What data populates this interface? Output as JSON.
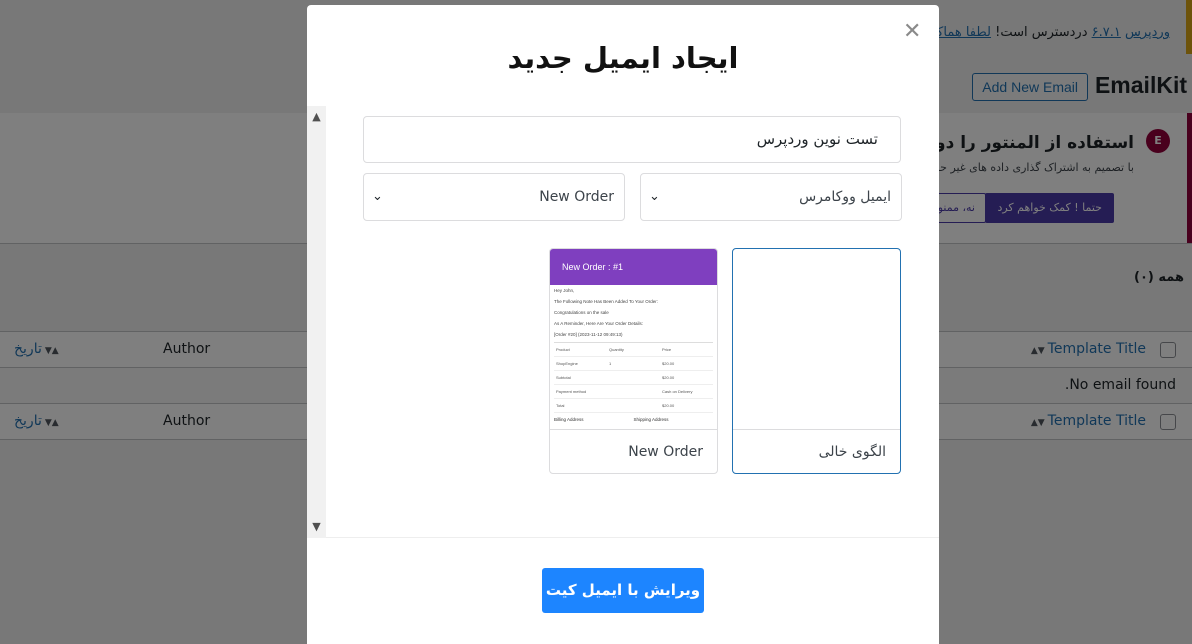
{
  "background": {
    "notice_text_1": "وردپرس",
    "notice_version": "۶.۷.۱",
    "notice_text_2": "دردسترس است!",
    "notice_link": "لطفا هماکنون",
    "page_title": "EmailKit",
    "add_new_label": "Add New Email",
    "elementor_logo": "E",
    "elementor_title": "استفاده از المنتور را دوستانه‌تر کنید",
    "elementor_desc": "با تصمیم به اشتراک گذاری داده های غیر حساس",
    "elementor_yes": "حتما ! کمک خواهم کرد",
    "elementor_no": "نه، ممنون",
    "filter_all": "همه (۰)",
    "table": {
      "col_title": "Template Title",
      "col_author": "Author",
      "col_date": "تاریخ",
      "empty": ".No email found"
    }
  },
  "modal": {
    "title": "ایجاد ایمیل جدید",
    "close_glyph": "✕",
    "name_value": "تست نوین وردپرس",
    "type_select": "ایمیل ووکامرس",
    "event_select": "New Order",
    "templates": [
      {
        "label": "الگوی خالی"
      },
      {
        "label": "New Order"
      }
    ],
    "preview": {
      "header": "New Order : #1",
      "greeting": "Hey John,",
      "line1": "The Following Note Has Been Added To Your Order:",
      "line2": "Congratulations on the sale",
      "line3": "As A Reminder, Here Are Your Order Details:",
      "order_ref": "[Order #20] (2023-11-12 09:49:13)",
      "rows": [
        [
          "Product",
          "Quantity",
          "Price"
        ],
        [
          "ShopEngine",
          "1",
          "$20.00"
        ],
        [
          "Subtotal",
          "",
          "$20.00"
        ],
        [
          "Payment method",
          "",
          "Cash on Delivery"
        ],
        [
          "Total",
          "",
          "$20.00"
        ]
      ],
      "billing": "Billing Address",
      "shipping": "Shipping Address"
    },
    "submit_label": "ویرایش با ایمیل کیت"
  },
  "colors": {
    "accent": "#1d85ff",
    "template_header": "#7f3fbf",
    "wp_link": "#2271b1"
  }
}
